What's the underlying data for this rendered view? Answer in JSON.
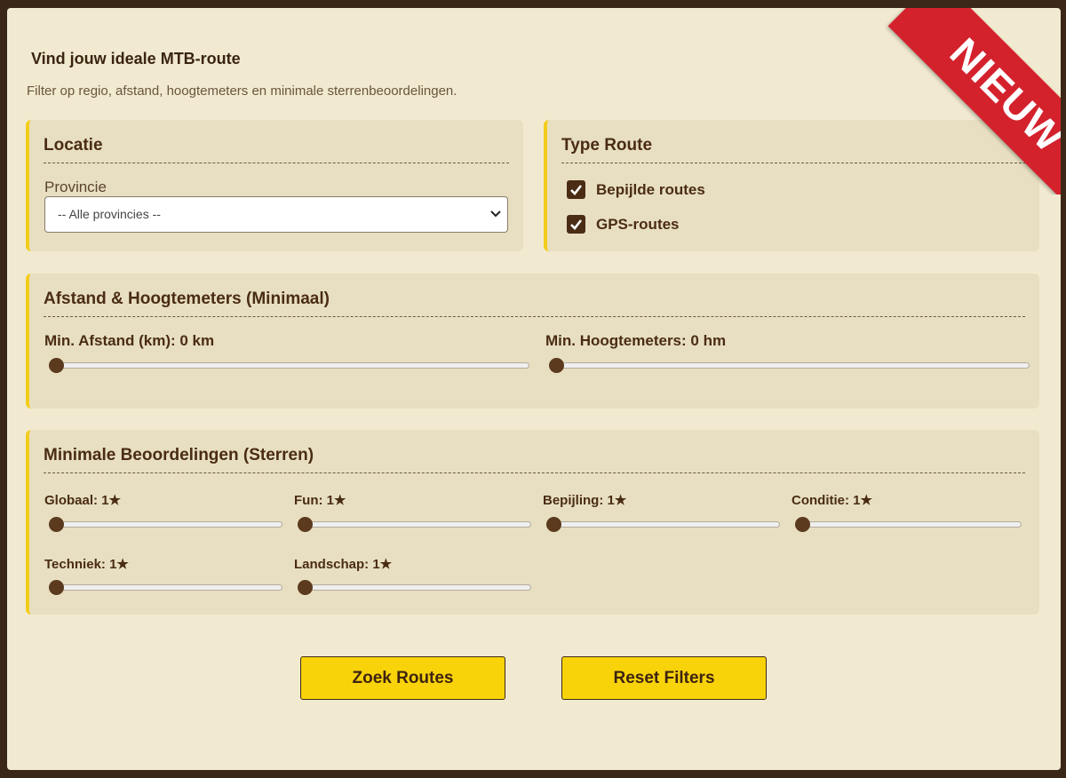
{
  "header": {
    "title": "Vind jouw ideale MTB-route",
    "subtitle": "Filter op regio, afstand, hoogtemeters en minimale sterrenbeoordelingen."
  },
  "badge": {
    "text": "NIEUW",
    "color": "#d4222d"
  },
  "location": {
    "heading": "Locatie",
    "province_label": "Provincie",
    "province_selected": "-- Alle provincies --"
  },
  "route_type": {
    "heading": "Type Route",
    "options": [
      {
        "label": "Bepijlde routes",
        "checked": true
      },
      {
        "label": "GPS-routes",
        "checked": true
      }
    ]
  },
  "distance": {
    "heading": "Afstand & Hoogtemeters (Minimaal)",
    "distance_label": "Min. Afstand (km): 0 km",
    "distance_value": 0,
    "elevation_label": "Min. Hoogtemeters: 0 hm",
    "elevation_value": 0
  },
  "ratings": {
    "heading": "Minimale Beoordelingen (Sterren)",
    "items": [
      {
        "label": "Globaal: 1★",
        "value": 1
      },
      {
        "label": "Fun: 1★",
        "value": 1
      },
      {
        "label": "Bepijling: 1★",
        "value": 1
      },
      {
        "label": "Conditie: 1★",
        "value": 1
      },
      {
        "label": "Techniek: 1★",
        "value": 1
      },
      {
        "label": "Landschap: 1★",
        "value": 1
      }
    ]
  },
  "actions": {
    "search_label": "Zoek Routes",
    "reset_label": "Reset Filters"
  },
  "colors": {
    "accent": "#f3cc1c",
    "button": "#f9d30a",
    "text": "#4a2c14",
    "background": "#f1ead0"
  }
}
